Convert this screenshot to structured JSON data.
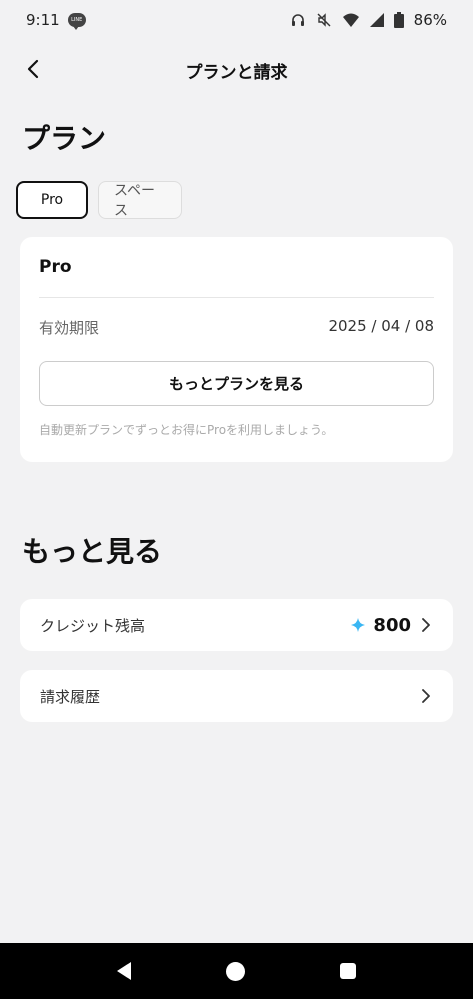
{
  "status_bar": {
    "time": "9:11",
    "notification_icon": "line-icon",
    "battery": "86%",
    "icons": [
      "headphones-icon",
      "mute-icon",
      "wifi-icon",
      "signal-icon",
      "battery-icon"
    ]
  },
  "header": {
    "title": "プランと請求",
    "back_icon": "chevron-left-icon"
  },
  "plan_section": {
    "title": "プラン",
    "tabs": [
      {
        "label": "Pro",
        "selected": true
      },
      {
        "label": "スペース",
        "selected": false
      }
    ],
    "card": {
      "plan_name": "Pro",
      "expiry_label": "有効期限",
      "expiry_value": "2025 / 04 / 08",
      "button_label": "もっとプランを見る",
      "hint": "自動更新プランでずっとお得にProを利用しましょう。"
    }
  },
  "more_section": {
    "title": "もっと見る",
    "items": [
      {
        "label": "クレジット残高",
        "value": "800",
        "icon": "sparkle-icon"
      },
      {
        "label": "請求履歴"
      }
    ]
  },
  "colors": {
    "background": "#f2f2f3",
    "card": "#ffffff",
    "accent_sparkle": "#39b6f3",
    "nav_bar": "#000000"
  }
}
